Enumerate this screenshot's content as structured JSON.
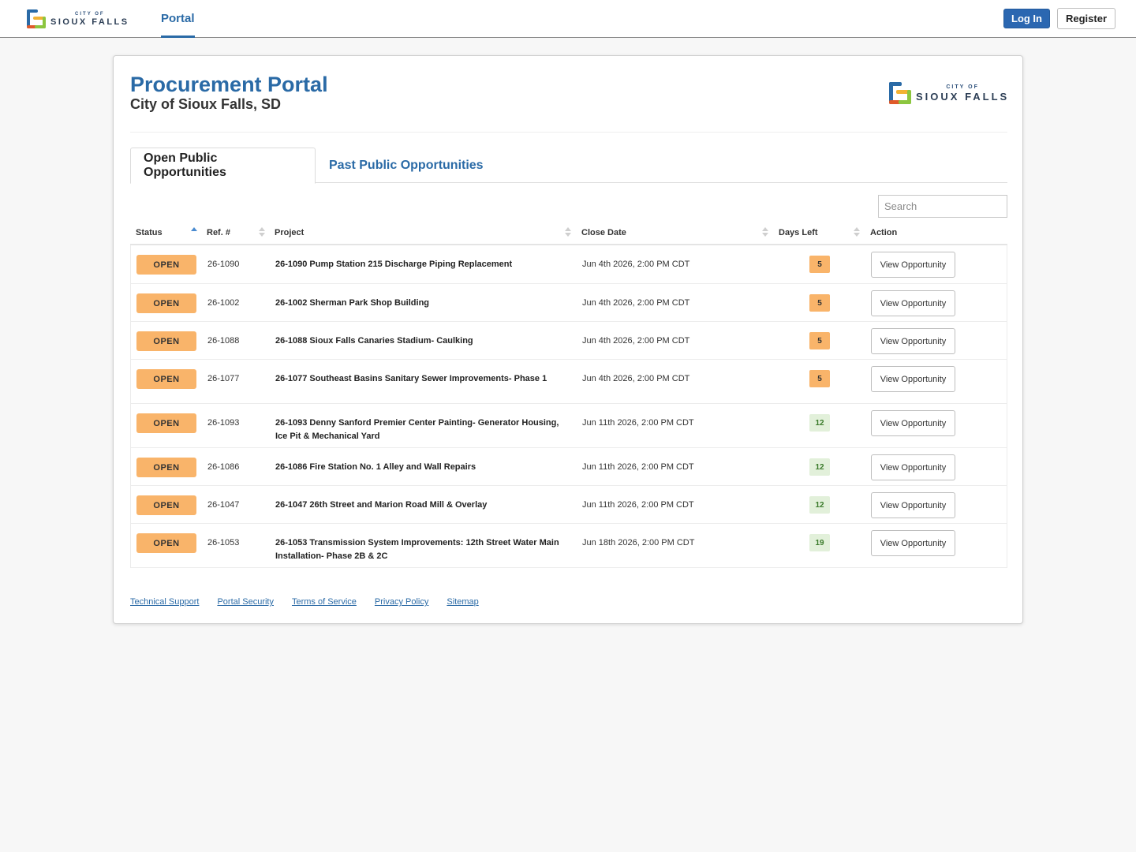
{
  "topbar": {
    "logo_small": "CITY OF",
    "logo_big": "SIOUX FALLS",
    "nav_portal": "Portal",
    "login_label": "Log In",
    "register_label": "Register"
  },
  "header": {
    "title": "Procurement Portal",
    "subtitle": "City of Sioux Falls, SD",
    "logo_small": "CITY OF",
    "logo_big": "SIOUX FALLS"
  },
  "tabs": [
    {
      "label": "Open Public Opportunities",
      "active": true
    },
    {
      "label": "Past Public Opportunities",
      "active": false
    }
  ],
  "search": {
    "placeholder": "Search"
  },
  "table": {
    "columns": [
      "Status",
      "Ref. #",
      "Project",
      "Close Date",
      "Days Left",
      "Action"
    ],
    "rows": [
      {
        "status": "OPEN",
        "ref": "26-1090",
        "project": "26-1090 Pump Station 215 Discharge Piping Replacement",
        "close_date": "Jun 4th 2026, 2:00 PM CDT",
        "days_left": "5",
        "action": "View Opportunity"
      },
      {
        "status": "OPEN",
        "ref": "26-1002",
        "project": "26-1002 Sherman Park Shop Building",
        "close_date": "Jun 4th 2026, 2:00 PM CDT",
        "days_left": "5",
        "action": "View Opportunity"
      },
      {
        "status": "OPEN",
        "ref": "26-1088",
        "project": "26-1088 Sioux Falls Canaries Stadium- Caulking",
        "close_date": "Jun 4th 2026, 2:00 PM CDT",
        "days_left": "5",
        "action": "View Opportunity"
      },
      {
        "status": "OPEN",
        "ref": "26-1077",
        "project": "26-1077 Southeast Basins Sanitary Sewer Improvements- Phase 1",
        "close_date": "Jun 4th 2026, 2:00 PM CDT",
        "days_left": "5",
        "action": "View Opportunity"
      },
      {
        "status": "OPEN",
        "ref": "26-1093",
        "project": "26-1093 Denny Sanford Premier Center Painting- Generator Housing, Ice Pit & Mechanical Yard",
        "close_date": "Jun 11th 2026, 2:00 PM CDT",
        "days_left": "12",
        "action": "View Opportunity"
      },
      {
        "status": "OPEN",
        "ref": "26-1086",
        "project": "26-1086 Fire Station No. 1 Alley and Wall Repairs",
        "close_date": "Jun 11th 2026, 2:00 PM CDT",
        "days_left": "12",
        "action": "View Opportunity"
      },
      {
        "status": "OPEN",
        "ref": "26-1047",
        "project": "26-1047 26th Street and Marion Road Mill & Overlay",
        "close_date": "Jun 11th 2026, 2:00 PM CDT",
        "days_left": "12",
        "action": "View Opportunity"
      },
      {
        "status": "OPEN",
        "ref": "26-1053",
        "project": "26-1053 Transmission System Improvements: 12th Street Water Main Installation- Phase 2B & 2C",
        "close_date": "Jun 18th 2026, 2:00 PM CDT",
        "days_left": "19",
        "action": "View Opportunity"
      }
    ]
  },
  "footer": {
    "links": [
      "Technical Support",
      "Portal Security",
      "Terms of Service",
      "Privacy Policy",
      "Sitemap"
    ]
  },
  "colors": {
    "brand_blue": "#2a6aa6",
    "login_button": "#2b67b1",
    "status_open": "#f9b46a",
    "days_warn": "#f9b46a",
    "days_ok_bg": "#e2f0da",
    "days_ok_text": "#3a7a2a"
  }
}
